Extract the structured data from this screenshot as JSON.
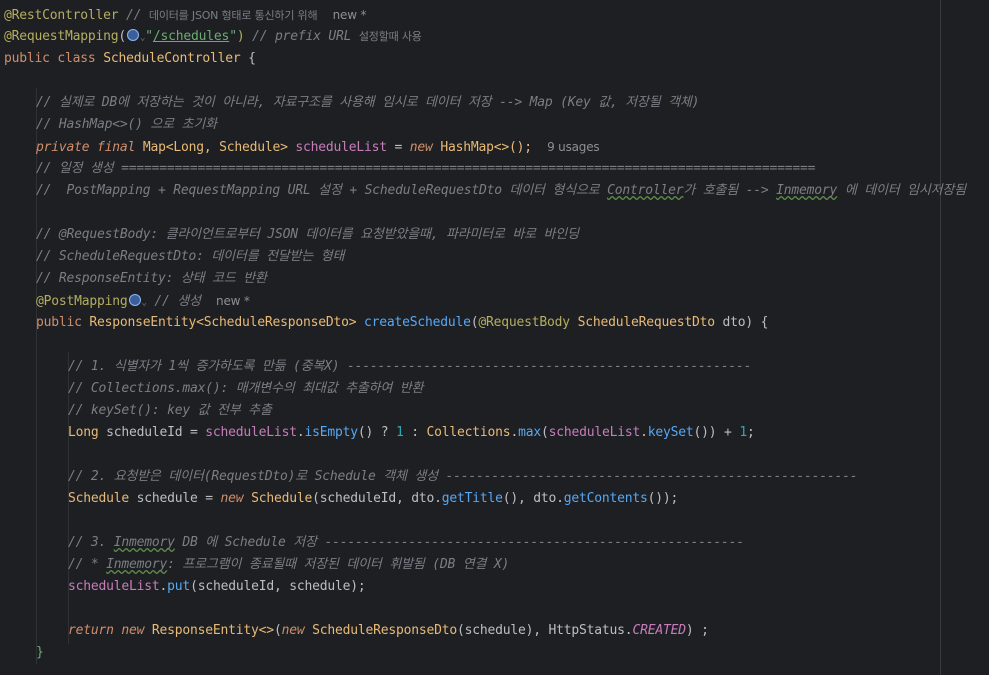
{
  "editor": {
    "lines": {
      "l1": {
        "ann": "@RestController",
        "comment": " // ",
        "comment_kr": "데이터를 JSON 형태로 통신하기 위해",
        "hint": "new *"
      },
      "l2": {
        "ann": "@RequestMapping",
        "open": "(",
        "quote1": "\"",
        "path": "/schedules",
        "quote2": "\"",
        "close": ")",
        "comment": " // prefix URL ",
        "comment_kr": "설정할때 사용"
      },
      "l3": {
        "kw1": "public",
        "kw2": "class",
        "name": "ScheduleController",
        "brace": " {"
      },
      "l5": {
        "comment": "// 실제로 DB에 저장하는 것이 아니라, 자료구조를 사용해 임시로 데이터 저장 --> Map (Key 값, 저장될 객체)"
      },
      "l6": {
        "comment": "// HashMap<>() 으로 초기화"
      },
      "l7": {
        "kw1": "private",
        "kw2": "final",
        "type": "Map<Long, Schedule>",
        "field": "scheduleList",
        "eq": " = ",
        "kw3": "new",
        "ctor": "HashMap<>();",
        "hint": "9 usages"
      },
      "l8": {
        "comment": "// 일정 생성 ==========================================================================================="
      },
      "l9": {
        "comment_a": "//  PostMapping + RequestMapping URL 설정 + ScheduleRequestDto 데이터 형식으로 ",
        "controller": "Controller",
        "comment_b": "가 호출됨 --> ",
        "inmemory": "Inmemory",
        "comment_c": " 에 데이터 임시저장됨"
      },
      "l11": {
        "comment": "// @RequestBody: 클라이언트로부터 JSON 데이터를 요청받았을때, 파라미터로 바로 바인딩"
      },
      "l12": {
        "comment": "// ScheduleRequestDto: 데이터를 전달받는 형태"
      },
      "l13": {
        "comment": "// ResponseEntity: 상태 코드 반환"
      },
      "l14": {
        "ann": "@PostMapping",
        "comment": " // 생성",
        "hint": "new *"
      },
      "l15": {
        "kw": "public",
        "type": "ResponseEntity<ScheduleResponseDto>",
        "method": "createSchedule",
        "open": "(",
        "ann": "@RequestBody",
        "ptype": "ScheduleRequestDto",
        "pname": "dto",
        "close": ") {"
      },
      "l17": {
        "comment": "// 1. 식별자가 1씩 증가하도록 만듦 (중복X) -----------------------------------------------------"
      },
      "l18": {
        "comment": "// Collections.max(): 매개변수의 최대값 추출하여 반환"
      },
      "l19": {
        "comment": "// keySet(): key 값 전부 추출"
      },
      "l20": {
        "type": "Long",
        "var": " scheduleId = ",
        "field1": "scheduleList",
        "dot1": ".",
        "m1": "isEmpty",
        "p1": "() ? ",
        "n1": "1",
        "colon": " : ",
        "cls": "Collections",
        "dot2": ".",
        "m2": "max",
        "p2": "(",
        "field2": "scheduleList",
        "dot3": ".",
        "m3": "keySet",
        "p3": "()) + ",
        "n2": "1",
        "end": ";"
      },
      "l22": {
        "comment": "// 2. 요청받은 데이터(RequestDto)로 Schedule 객체 생성 ------------------------------------------------------"
      },
      "l23": {
        "type": "Schedule",
        "var": " schedule = ",
        "kw": "new",
        "ctor": " Schedule",
        "p1": "(scheduleId, dto.",
        "m1": "getTitle",
        "p2": "(), dto.",
        "m2": "getContents",
        "p3": "());"
      },
      "l25": {
        "c1": "// 3. ",
        "inmemory": "Inmemory",
        "c2": " DB 에 Schedule 저장 -------------------------------------------------------"
      },
      "l26": {
        "c1": "// * ",
        "inmemory": "Inmemory",
        "c2": ": 프로그램이 종료될때 저장된 데이터 휘발됨 (DB 연결 X)"
      },
      "l27": {
        "field": "scheduleList",
        "dot": ".",
        "m": "put",
        "rest": "(scheduleId, schedule);"
      },
      "l29": {
        "kw1": "return",
        "kw2": " new",
        "ctor": " ResponseEntity<>",
        "p1": "(",
        "kw3": "new",
        "ctor2": " ScheduleResponseDto",
        "p2": "(schedule), HttpStatus.",
        "const": "CREATED",
        "p3": ") ;"
      },
      "l30": {
        "brace": "}"
      }
    }
  },
  "colors": {
    "background": "#1e1f22",
    "keyword": "#cf8e6d",
    "annotation": "#b3ae60",
    "field": "#c77dbb",
    "method": "#56a8f5",
    "string": "#6aab73",
    "number": "#2aacb8",
    "comment": "#7a7e85"
  },
  "icons": [
    "globe-icon",
    "chevron-down-icon"
  ]
}
